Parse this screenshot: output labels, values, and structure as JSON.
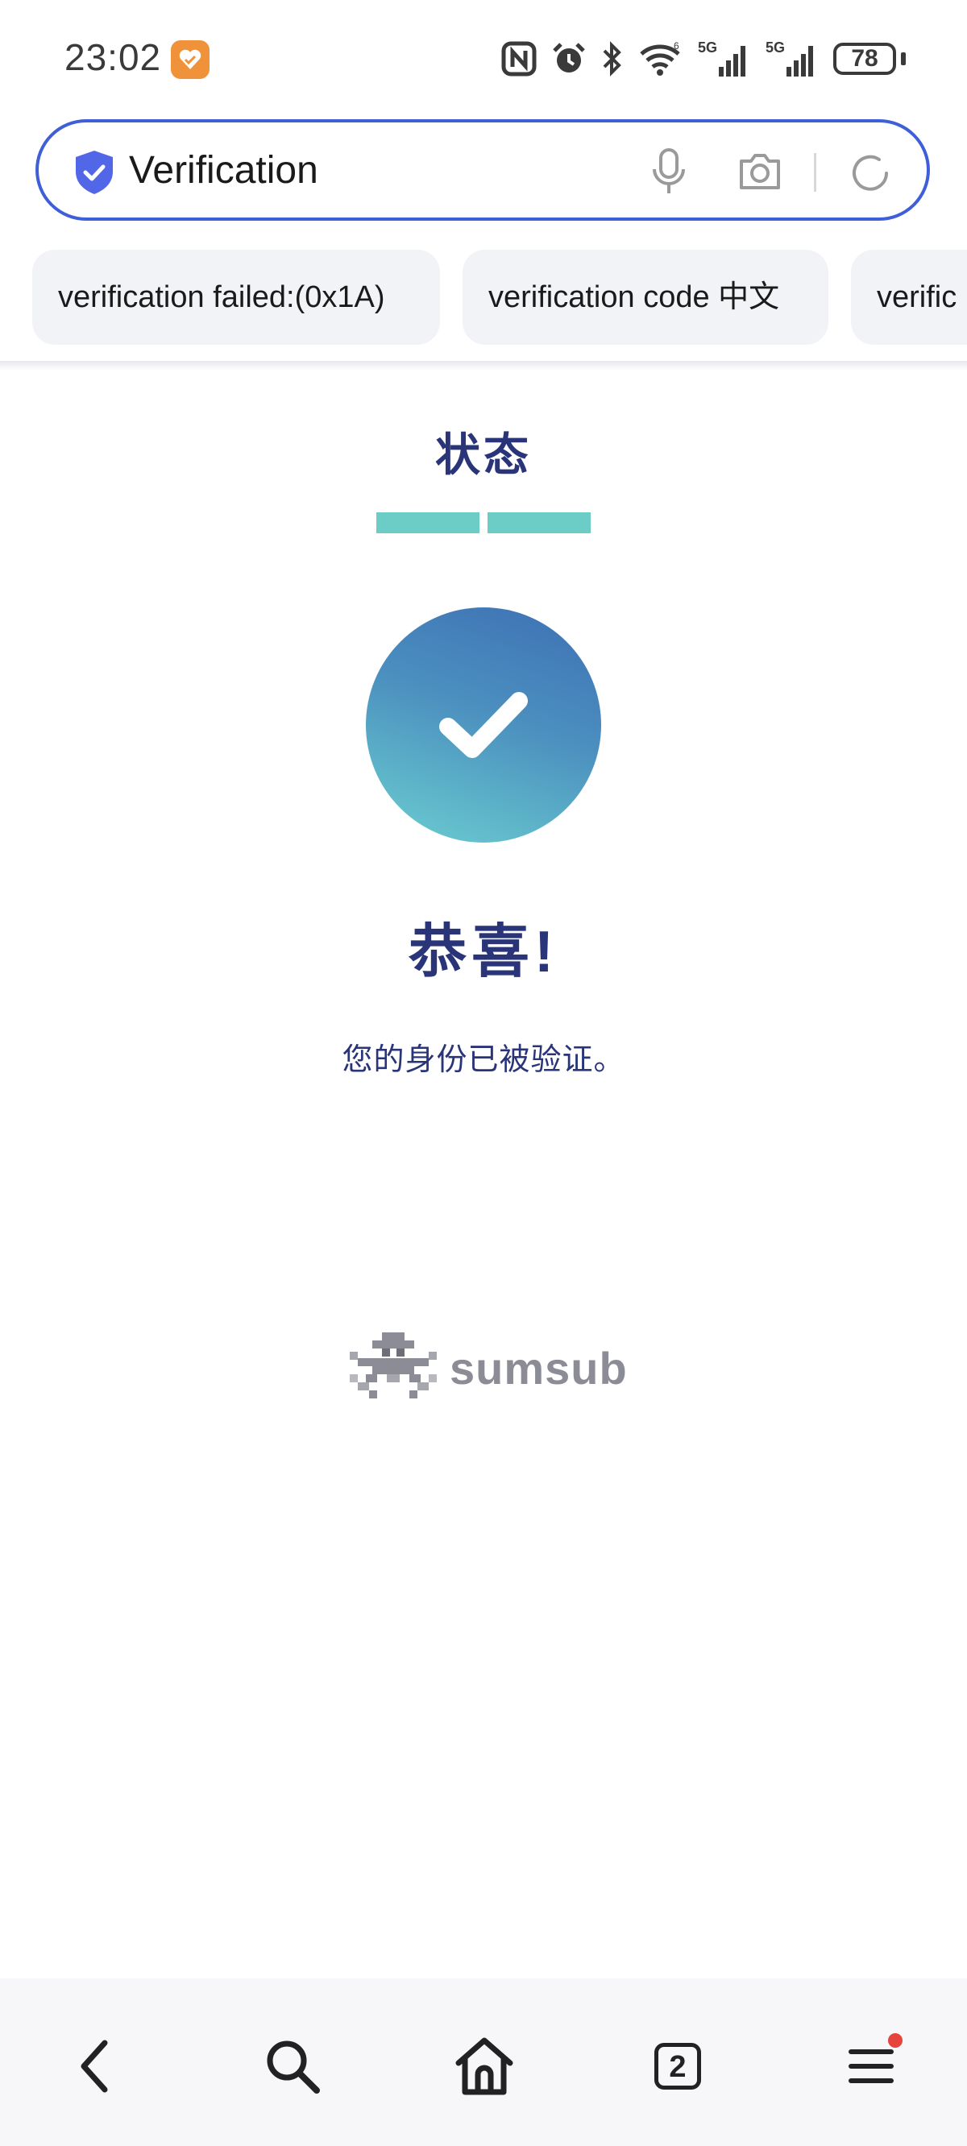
{
  "status_bar": {
    "time": "23:02",
    "battery": "78",
    "icons": [
      "nfc-icon",
      "alarm-icon",
      "bluetooth-icon",
      "wifi-icon",
      "signal-5g-icon",
      "signal-5g-icon",
      "battery-icon"
    ]
  },
  "search": {
    "query": "Verification",
    "icons": [
      "shield-icon",
      "mic-icon",
      "camera-icon",
      "refresh-icon"
    ]
  },
  "suggestions": [
    {
      "label": "verification failed:(0x1A)"
    },
    {
      "label": "verification code 中文"
    },
    {
      "label": "verific"
    }
  ],
  "main": {
    "title": "状态",
    "progress_segments_completed": 2,
    "progress_segments_total": 2,
    "heading": "恭喜!",
    "message": "您的身份已被验证。",
    "brand": "sumsub"
  },
  "bottom_nav": {
    "tab_count": "2",
    "icons": [
      "back-icon",
      "search-icon",
      "home-icon",
      "tabs-icon",
      "menu-icon"
    ]
  },
  "colors": {
    "accent": "#3f5fd8",
    "primary_text": "#2a3478",
    "progress": "#6cccc6",
    "notification": "#e5453b"
  }
}
